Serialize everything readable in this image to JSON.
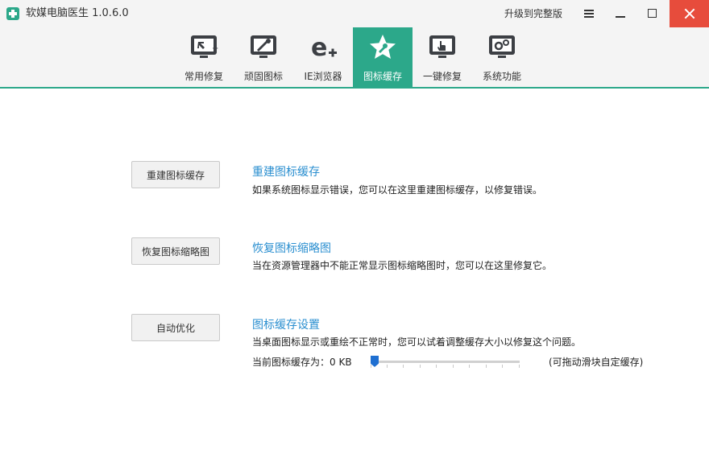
{
  "window": {
    "title": "软媒电脑医生 1.0.6.0",
    "upgrade_label": "升级到完整版"
  },
  "tabs": [
    {
      "label": "常用修复",
      "icon": "monitor-cursor-icon",
      "active": false
    },
    {
      "label": "顽固图标",
      "icon": "monitor-wand-icon",
      "active": false
    },
    {
      "label": "IE浏览器",
      "icon": "ie-browser-icon",
      "active": false
    },
    {
      "label": "图标缓存",
      "icon": "star-wrench-icon",
      "active": true
    },
    {
      "label": "一键修复",
      "icon": "monitor-hand-icon",
      "active": false
    },
    {
      "label": "系统功能",
      "icon": "monitor-gears-icon",
      "active": false
    }
  ],
  "rows": [
    {
      "button": "重建图标缓存",
      "title": "重建图标缓存",
      "desc": "如果系统图标显示错误，您可以在这里重建图标缓存，以修复错误。"
    },
    {
      "button": "恢复图标缩略图",
      "title": "恢复图标缩略图",
      "desc": "当在资源管理器中不能正常显示图标缩略图时，您可以在这里修复它。"
    },
    {
      "button": "自动优化",
      "title": "图标缓存设置",
      "desc": "当桌面图标显示或重绘不正常时，您可以试着调整缓存大小以修复这个问题。"
    }
  ],
  "cache": {
    "label": "当前图标缓存为：0 KB",
    "slider_value": 0,
    "hint": "(可拖动滑块自定缓存)"
  },
  "colors": {
    "accent": "#2ca88a",
    "link": "#2b8fd0",
    "close": "#e74c3c",
    "slider_thumb": "#1f6fd1"
  }
}
